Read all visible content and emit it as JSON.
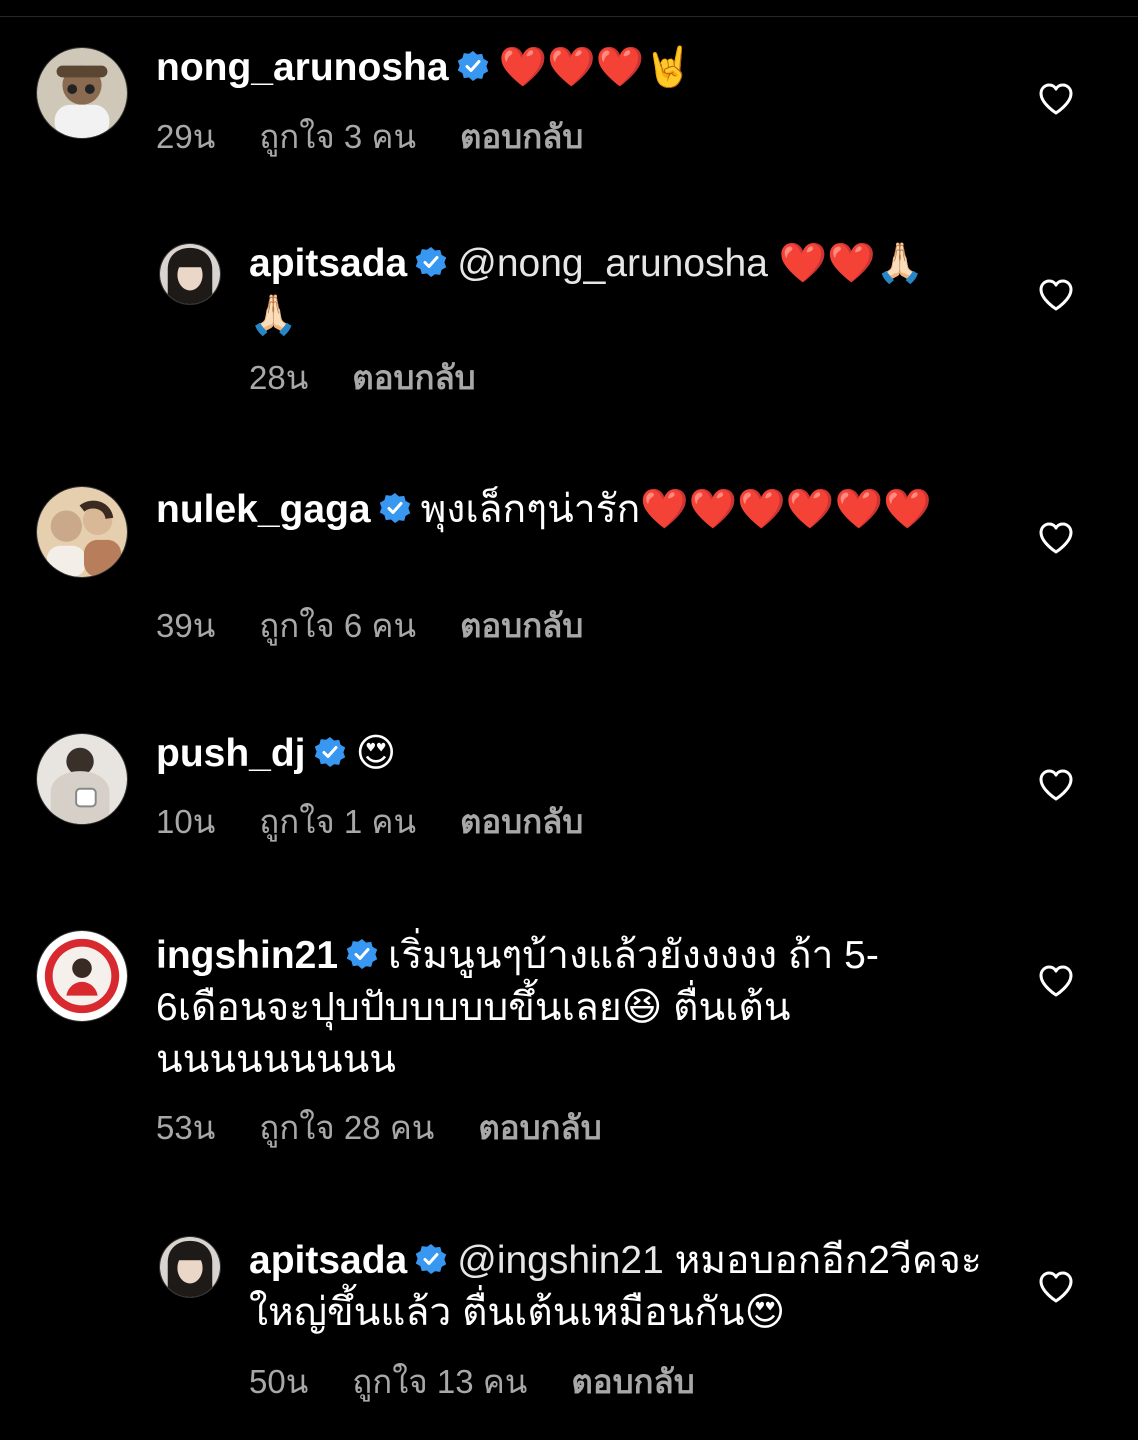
{
  "comments": [
    {
      "username": "nong_arunosha",
      "text": "❤️❤️❤️🤘",
      "time": "29น",
      "likes": "ถูกใจ 3 คน",
      "reply": "ตอบกลับ"
    },
    {
      "username": "apitsada",
      "mention": "@nong_arunosha",
      "text": "❤️❤️🙏🏻🙏🏻",
      "time": "28น",
      "reply": "ตอบกลับ"
    },
    {
      "username": "nulek_gaga",
      "text": "พุงเล็กๆน่ารัก❤️❤️❤️❤️❤️❤️",
      "time": "39น",
      "likes": "ถูกใจ 6 คน",
      "reply": "ตอบกลับ"
    },
    {
      "username": "push_dj",
      "text": "😍",
      "time": "10น",
      "likes": "ถูกใจ 1 คน",
      "reply": "ตอบกลับ"
    },
    {
      "username": "ingshin21",
      "text": "เริ่มนูนๆบ้างแล้วยังงงงง ถ้า 5-6เดือนจะปุบปับบบบบขึ้นเลย😆 ตื่นเต้นนนนนนนนนน",
      "time": "53น",
      "likes": "ถูกใจ 28 คน",
      "reply": "ตอบกลับ"
    },
    {
      "username": "apitsada",
      "mention": "@ingshin21",
      "text": "หมอบอกอีก2วีคจะใหญ่ขึ้นแล้ว ตื่นเต้นเหมือนกัน😍",
      "time": "50น",
      "likes": "ถูกใจ 13 คน",
      "reply": "ตอบกลับ"
    }
  ],
  "icons": {
    "verified": "verified-badge-icon",
    "like": "heart-outline-icon"
  },
  "colors": {
    "background": "#000000",
    "text": "#ffffff",
    "meta": "#a8a8a8",
    "verified": "#3897f0"
  }
}
